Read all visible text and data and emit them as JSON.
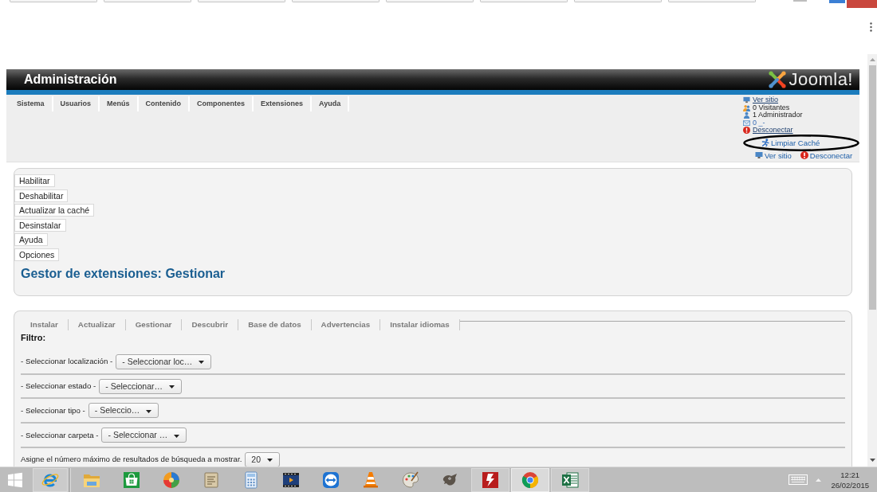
{
  "header": {
    "title": "Administración",
    "logo_text": "Joomla!"
  },
  "menu": [
    "Sistema",
    "Usuarios",
    "Menús",
    "Contenido",
    "Componentes",
    "Extensiones",
    "Ayuda"
  ],
  "status": [
    {
      "kind": "site",
      "text": "Ver sitio"
    },
    {
      "kind": "visitors",
      "text": "0 Visitantes"
    },
    {
      "kind": "admins",
      "text": "1 Administrador"
    },
    {
      "kind": "messages",
      "text": "0 _-"
    },
    {
      "kind": "logout",
      "text": "Desconectar"
    }
  ],
  "quick_links": [
    {
      "kind": "cache",
      "text": "Limpiar Caché",
      "circled": true
    },
    {
      "kind": "site",
      "text": "Ver sitio",
      "circled": false
    },
    {
      "kind": "logout",
      "text": "Desconectar",
      "circled": false
    }
  ],
  "toolbar": [
    "Habilitar",
    "Deshabilitar",
    "Actualizar la caché",
    "Desinstalar",
    "Ayuda",
    "Opciones"
  ],
  "page_title": "Gestor de extensiones: Gestionar",
  "tabs": [
    "Instalar",
    "Actualizar",
    "Gestionar",
    "Descubrir",
    "Base de datos",
    "Advertencias",
    "Instalar idiomas"
  ],
  "filter": {
    "title": "Filtro:",
    "rows": [
      {
        "label": "- Seleccionar localización -",
        "value": "- Seleccionar loc…"
      },
      {
        "label": "- Seleccionar estado -",
        "value": "- Seleccionar…"
      },
      {
        "label": "- Seleccionar tipo -",
        "value": "- Seleccio…"
      },
      {
        "label": "- Seleccionar carpeta -",
        "value": "- Seleccionar …"
      }
    ]
  },
  "limit": {
    "label": "Asigne el número máximo de resultados de búsqueda a mostrar.",
    "value": "20"
  },
  "taskbar": {
    "apps": [
      {
        "kind": "ie",
        "running": true,
        "selected": false
      },
      {
        "kind": "folder",
        "running": false,
        "selected": false
      },
      {
        "kind": "store",
        "running": false,
        "selected": false
      },
      {
        "kind": "ball",
        "running": false,
        "selected": false
      },
      {
        "kind": "notes",
        "running": false,
        "selected": false
      },
      {
        "kind": "calculator",
        "running": false,
        "selected": false
      },
      {
        "kind": "film",
        "running": false,
        "selected": false
      },
      {
        "kind": "remote",
        "running": false,
        "selected": false
      },
      {
        "kind": "cone",
        "running": false,
        "selected": false
      },
      {
        "kind": "palette",
        "running": false,
        "selected": false
      },
      {
        "kind": "animal",
        "running": false,
        "selected": false
      },
      {
        "kind": "ftp",
        "running": true,
        "selected": false
      },
      {
        "kind": "chrome",
        "running": true,
        "selected": true
      },
      {
        "kind": "sheet",
        "running": true,
        "selected": false
      }
    ],
    "time": "12:21",
    "date": "26/02/2015"
  }
}
